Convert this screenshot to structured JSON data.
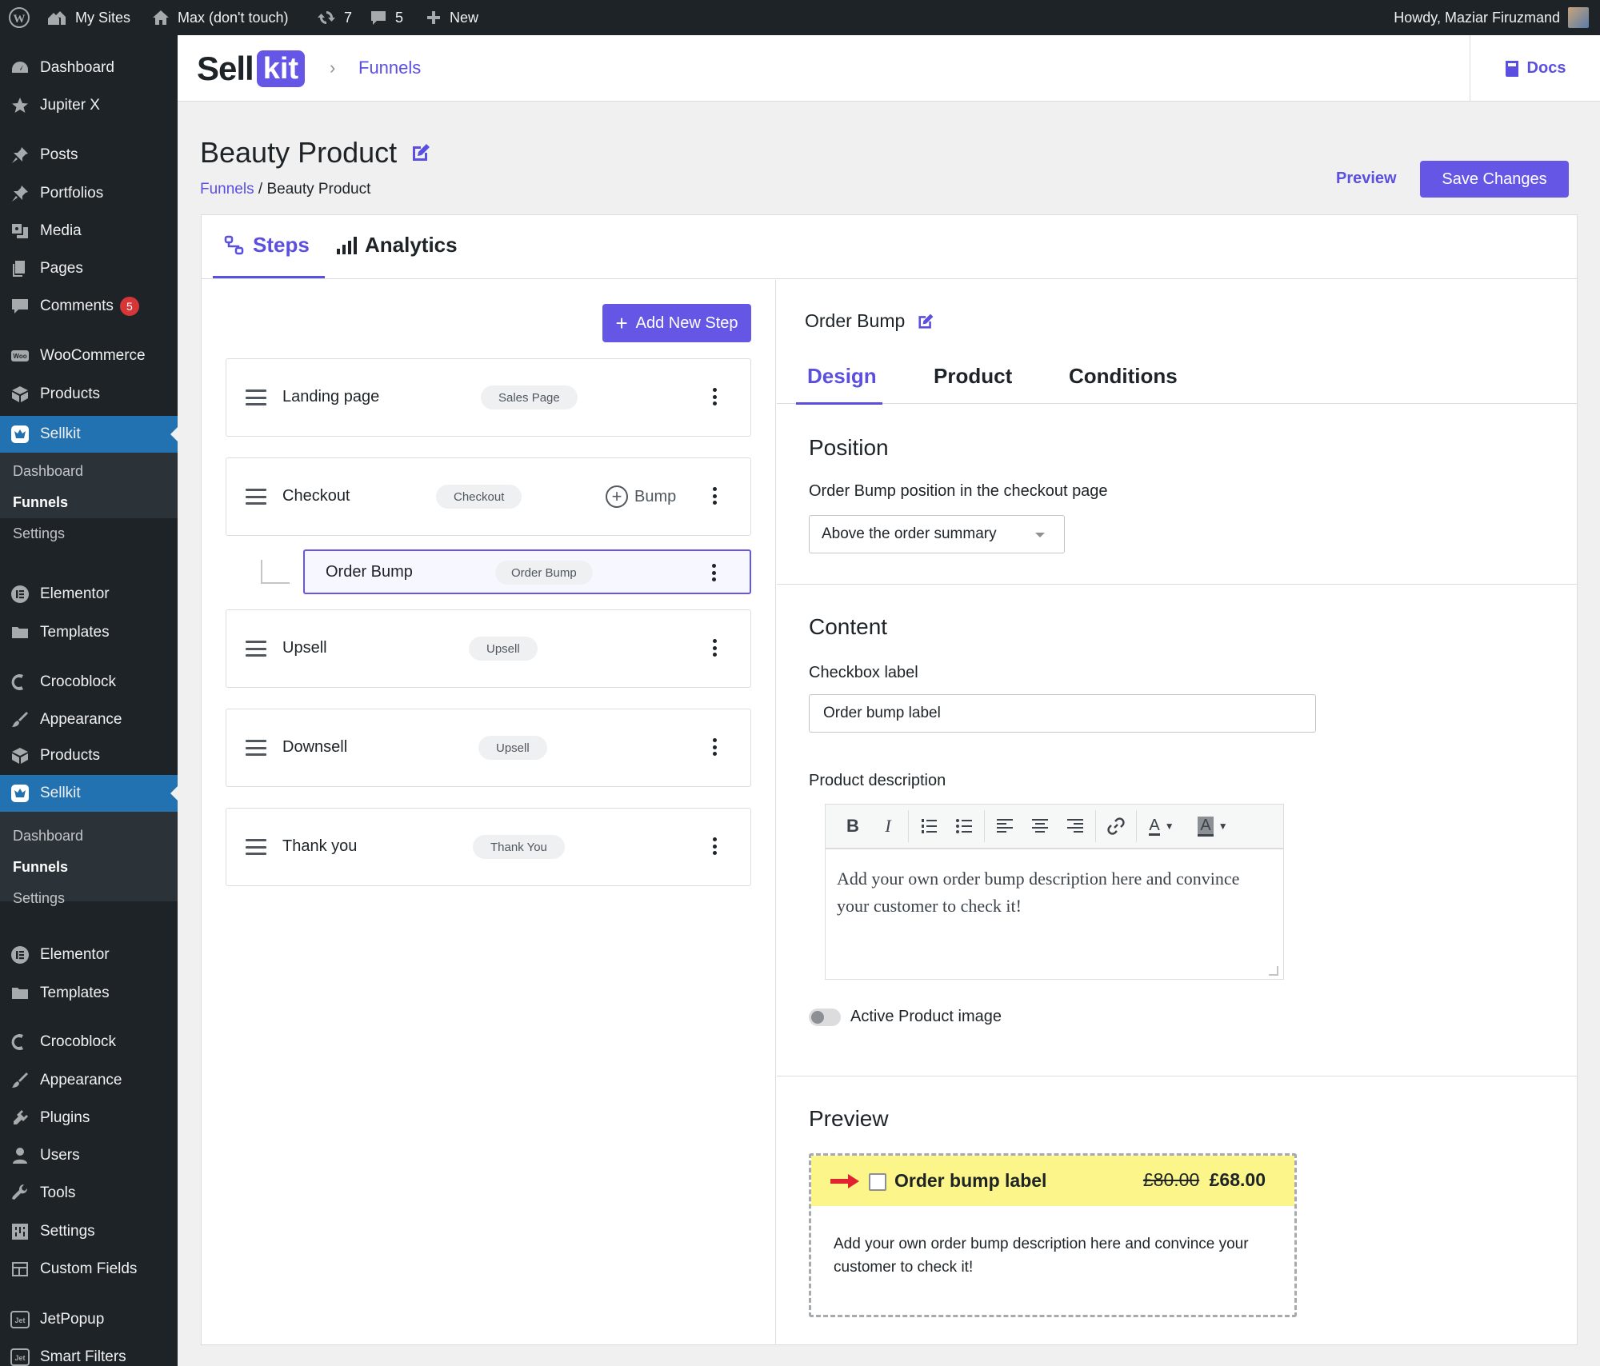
{
  "admin_bar": {
    "my_sites": "My Sites",
    "site_name": "Max (don't touch)",
    "updates_count": "7",
    "comments_count": "5",
    "new_label": "New",
    "howdy": "Howdy, Maziar Firuzmand"
  },
  "sidebar": {
    "items": [
      {
        "label": "Dashboard",
        "icon": "dashboard-icon"
      },
      {
        "label": "Jupiter X",
        "icon": "star-icon"
      },
      {
        "label": "Posts",
        "icon": "pin-icon"
      },
      {
        "label": "Portfolios",
        "icon": "pin-icon"
      },
      {
        "label": "Media",
        "icon": "media-icon"
      },
      {
        "label": "Pages",
        "icon": "pages-icon"
      },
      {
        "label": "Comments",
        "icon": "comment-icon",
        "badge": "5"
      },
      {
        "label": "WooCommerce",
        "icon": "woo-icon"
      },
      {
        "label": "Products",
        "icon": "box-icon"
      },
      {
        "label": "Sellkit",
        "icon": "sellkit-icon"
      },
      {
        "label": "Elementor",
        "icon": "elementor-icon"
      },
      {
        "label": "Templates",
        "icon": "folder-icon"
      },
      {
        "label": "Crocoblock",
        "icon": "crocoblock-icon"
      },
      {
        "label": "Appearance",
        "icon": "brush-icon"
      },
      {
        "label": "Products",
        "icon": "box-icon"
      },
      {
        "label": "Sellkit",
        "icon": "sellkit-icon"
      },
      {
        "label": "Elementor",
        "icon": "elementor-icon"
      },
      {
        "label": "Templates",
        "icon": "folder-icon"
      },
      {
        "label": "Crocoblock",
        "icon": "crocoblock-icon"
      },
      {
        "label": "Appearance",
        "icon": "brush-icon"
      },
      {
        "label": "Plugins",
        "icon": "plugin-icon"
      },
      {
        "label": "Users",
        "icon": "user-icon"
      },
      {
        "label": "Tools",
        "icon": "wrench-icon"
      },
      {
        "label": "Settings",
        "icon": "settings-icon"
      },
      {
        "label": "Custom Fields",
        "icon": "table-icon"
      },
      {
        "label": "JetPopup",
        "icon": "jet-icon"
      },
      {
        "label": "Smart Filters",
        "icon": "jet-icon"
      }
    ],
    "submenu": {
      "dashboard": "Dashboard",
      "funnels": "Funnels",
      "settings": "Settings"
    }
  },
  "header": {
    "logo_sell": "Sell",
    "logo_kit": "kit",
    "crumb": "Funnels",
    "docs": "Docs"
  },
  "page": {
    "title": "Beauty Product",
    "breadcrumb_link": "Funnels",
    "breadcrumb_sep": "/",
    "breadcrumb_current": "Beauty Product",
    "preview": "Preview",
    "save": "Save Changes"
  },
  "tabs": {
    "steps": "Steps",
    "analytics": "Analytics"
  },
  "steps": {
    "add_button": "Add New Step",
    "bump_action": "Bump",
    "list": [
      {
        "name": "Landing page",
        "type": "Sales Page"
      },
      {
        "name": "Checkout",
        "type": "Checkout"
      },
      {
        "name": "Upsell",
        "type": "Upsell"
      },
      {
        "name": "Downsell",
        "type": "Upsell"
      },
      {
        "name": "Thank you",
        "type": "Thank You"
      }
    ],
    "bump": {
      "name": "Order Bump",
      "type": "Order Bump"
    }
  },
  "panel": {
    "title": "Order Bump",
    "tabs": [
      "Design",
      "Product",
      "Conditions"
    ],
    "position": {
      "title": "Position",
      "label": "Order Bump position in the checkout page",
      "value": "Above the order summary"
    },
    "content": {
      "title": "Content",
      "checkbox_label": "Checkbox label",
      "checkbox_value": "Order bump label",
      "description_label": "Product description",
      "description_text": "Add your own order bump description here and convince your customer to check it!",
      "toggle_label": "Active Product image"
    },
    "preview": {
      "title": "Preview",
      "label": "Order bump label",
      "old_price": "£80.00",
      "new_price": "£68.00",
      "description": "Add your own order bump description here and convince your customer to check it!"
    }
  },
  "colors": {
    "accent": "#6556e6",
    "wp_blue": "#2271b1",
    "admin_dark": "#1d2327",
    "highlight_yellow": "#fbf58a"
  }
}
